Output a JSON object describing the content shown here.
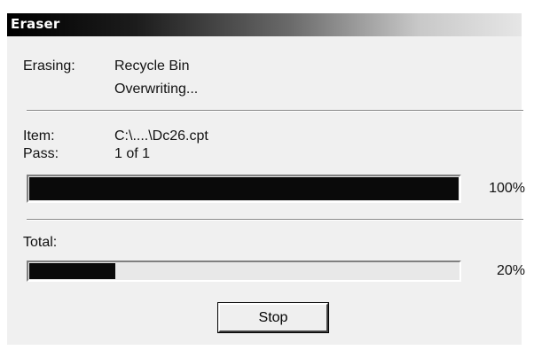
{
  "window": {
    "title": "Eraser"
  },
  "erasing": {
    "label": "Erasing:",
    "target": "Recycle Bin",
    "status": "Overwriting..."
  },
  "item": {
    "label": "Item:",
    "value": "C:\\....\\Dc26.cpt"
  },
  "pass": {
    "label": "Pass:",
    "value": "1 of 1"
  },
  "item_progress": {
    "percent_text": "100%",
    "fraction": 1.0
  },
  "total": {
    "label": "Total:",
    "percent_text": "20%",
    "fraction": 0.2
  },
  "buttons": {
    "stop_label": "Stop"
  },
  "colors": {
    "progress_fill": "#0a0a0a",
    "titlebar_start": "#000000",
    "titlebar_end": "#e6e6e6"
  }
}
